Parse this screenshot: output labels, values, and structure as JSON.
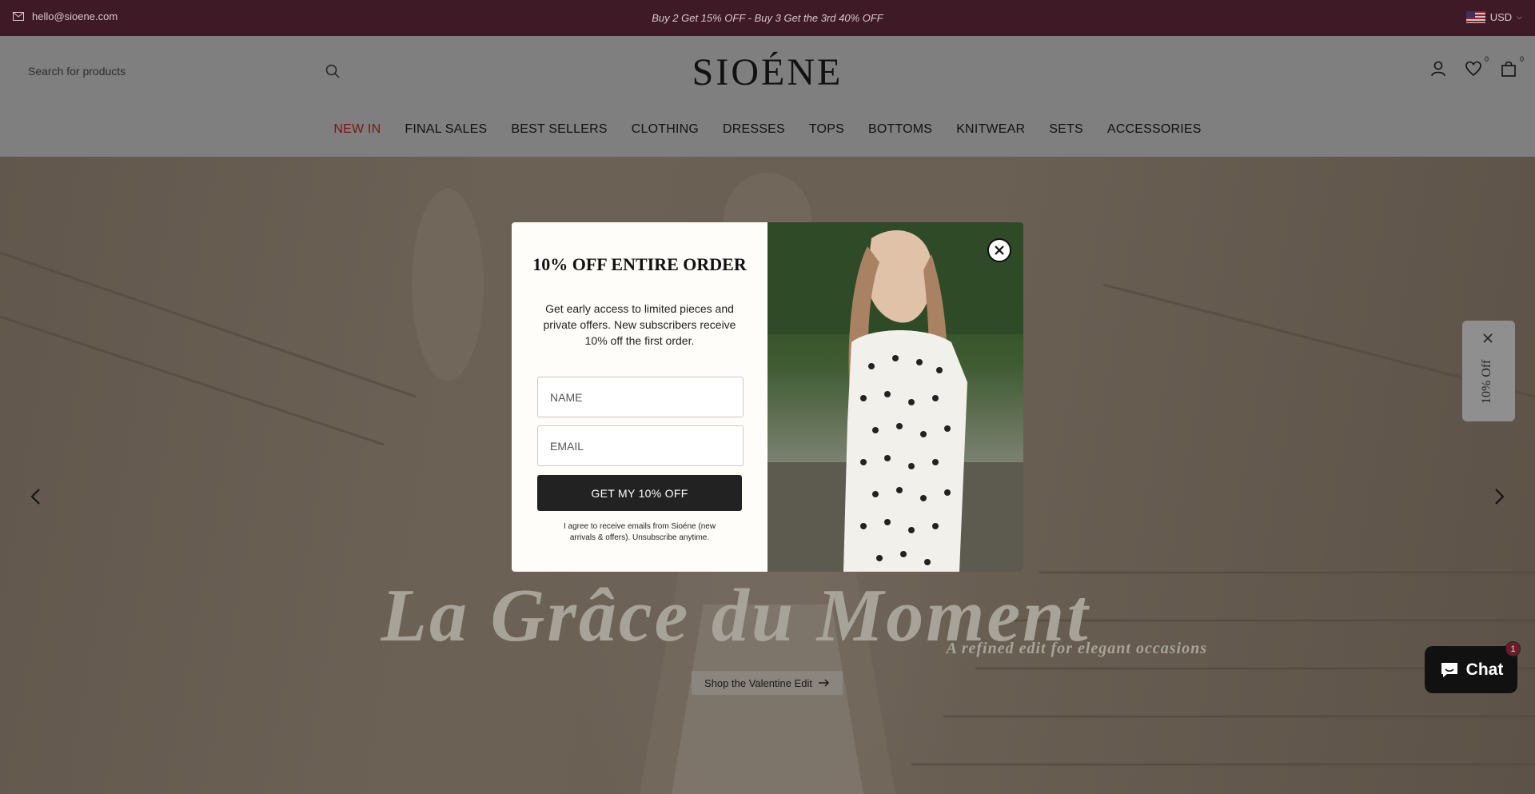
{
  "topbar": {
    "email": "hello@sioene.com",
    "promo": "Buy 2 Get 15% OFF - Buy 3 Get the 3rd 40% OFF",
    "currency": "USD"
  },
  "header": {
    "search_placeholder": "Search for products",
    "logo": "SIOÉNE",
    "wishlist_count": "0",
    "cart_count": "0"
  },
  "nav": {
    "items": [
      {
        "label": "NEW IN"
      },
      {
        "label": "FINAL SALES"
      },
      {
        "label": "BEST SELLERS"
      },
      {
        "label": "CLOTHING"
      },
      {
        "label": "DRESSES"
      },
      {
        "label": "TOPS"
      },
      {
        "label": "BOTTOMS"
      },
      {
        "label": "KNITWEAR"
      },
      {
        "label": "SETS"
      },
      {
        "label": "ACCESSORIES"
      }
    ]
  },
  "hero": {
    "headline": "La Grâce du Moment",
    "subheadline": "A refined edit for elegant occasions",
    "cta_label": "Shop the Valentine Edit"
  },
  "popup": {
    "title": "10% OFF ENTIRE ORDER",
    "description": "Get early access to limited pieces and private offers. New subscribers receive 10% off the first order.",
    "name_placeholder": "NAME",
    "email_placeholder": "EMAIL",
    "button_label": "GET MY 10% OFF",
    "legal": "I agree to receive emails from Sioéne (new arrivals & offers). Unsubscribe anytime."
  },
  "side_tab": {
    "label": "10% Off"
  },
  "chat": {
    "label": "Chat",
    "badge": "1"
  },
  "colors": {
    "topbar_bg": "#3d1a26",
    "nav_highlight": "#7a1515",
    "button_dark": "#222222"
  }
}
